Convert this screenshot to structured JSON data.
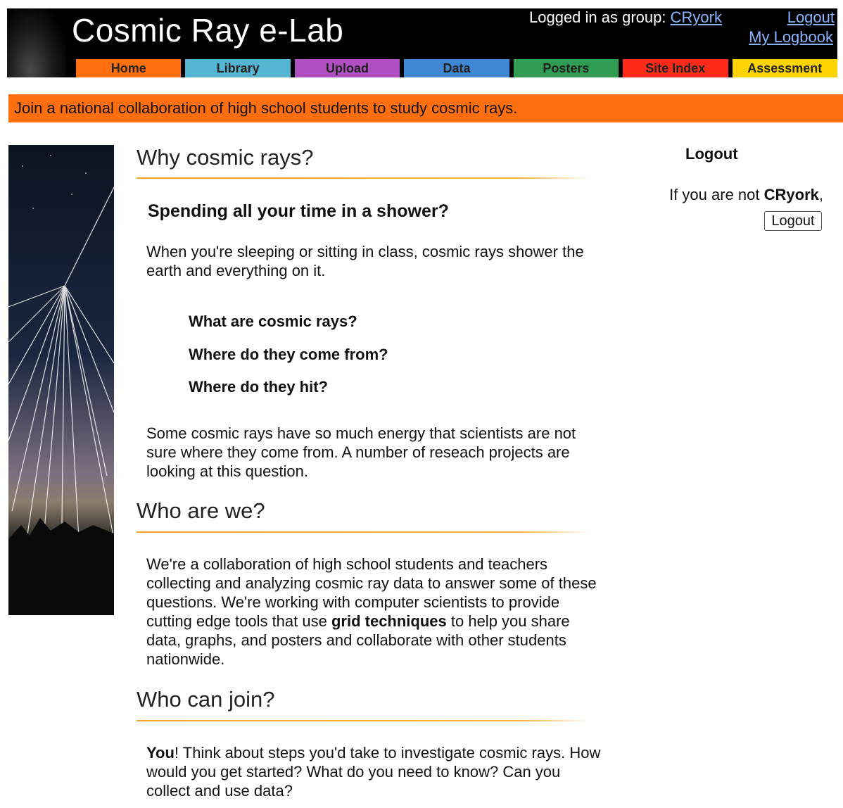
{
  "header": {
    "title": "Cosmic Ray e-Lab",
    "logged_in_prefix": "Logged in as group: ",
    "group": "CRyork",
    "logout_link": "Logout",
    "logbook_link": "My Logbook"
  },
  "nav": {
    "tabs": [
      {
        "label": "Home",
        "color": "#ff6f0f"
      },
      {
        "label": "Library",
        "color": "#56b4d3"
      },
      {
        "label": "Upload",
        "color": "#b04fc2"
      },
      {
        "label": "Data",
        "color": "#3f86d4"
      },
      {
        "label": "Posters",
        "color": "#2f9c52"
      },
      {
        "label": "Site Index",
        "color": "#ff2a1a"
      },
      {
        "label": "Assessment",
        "color": "#ffd400"
      }
    ]
  },
  "banner": {
    "text": "Join a national collaboration of high school students to study cosmic rays.",
    "color": "#ff6f0f"
  },
  "main": {
    "section1": {
      "heading": "Why cosmic rays?",
      "subheading": "Spending all your time in a shower?",
      "para1": "When you're sleeping or sitting in class, cosmic rays shower the earth and everything on it.",
      "questions": [
        "What are cosmic rays?",
        "Where do they come from?",
        "Where do they hit?"
      ],
      "para2": "Some cosmic rays have so much energy that scientists are not sure where they come from. A number of reseach projects are looking at this question."
    },
    "section2": {
      "heading": "Who are we?",
      "para_before": "We're a collaboration of high school students and teachers collecting and analyzing cosmic ray data to answer some of these questions. We're working with computer scientists to provide cutting edge tools that use ",
      "para_bold": "grid techniques",
      "para_after": " to help you share data, graphs, and posters and collaborate with other students nationwide."
    },
    "section3": {
      "heading": "Who can join?",
      "para_bold": "You",
      "para_after": "! Think about steps you'd take to investigate cosmic rays. How would you get started? What do you need to know? Can you collect and use data?"
    }
  },
  "side_panel": {
    "title": "Logout",
    "text_prefix": "If you are not ",
    "user": "CRyork",
    "text_suffix": ",",
    "button_label": "Logout"
  }
}
